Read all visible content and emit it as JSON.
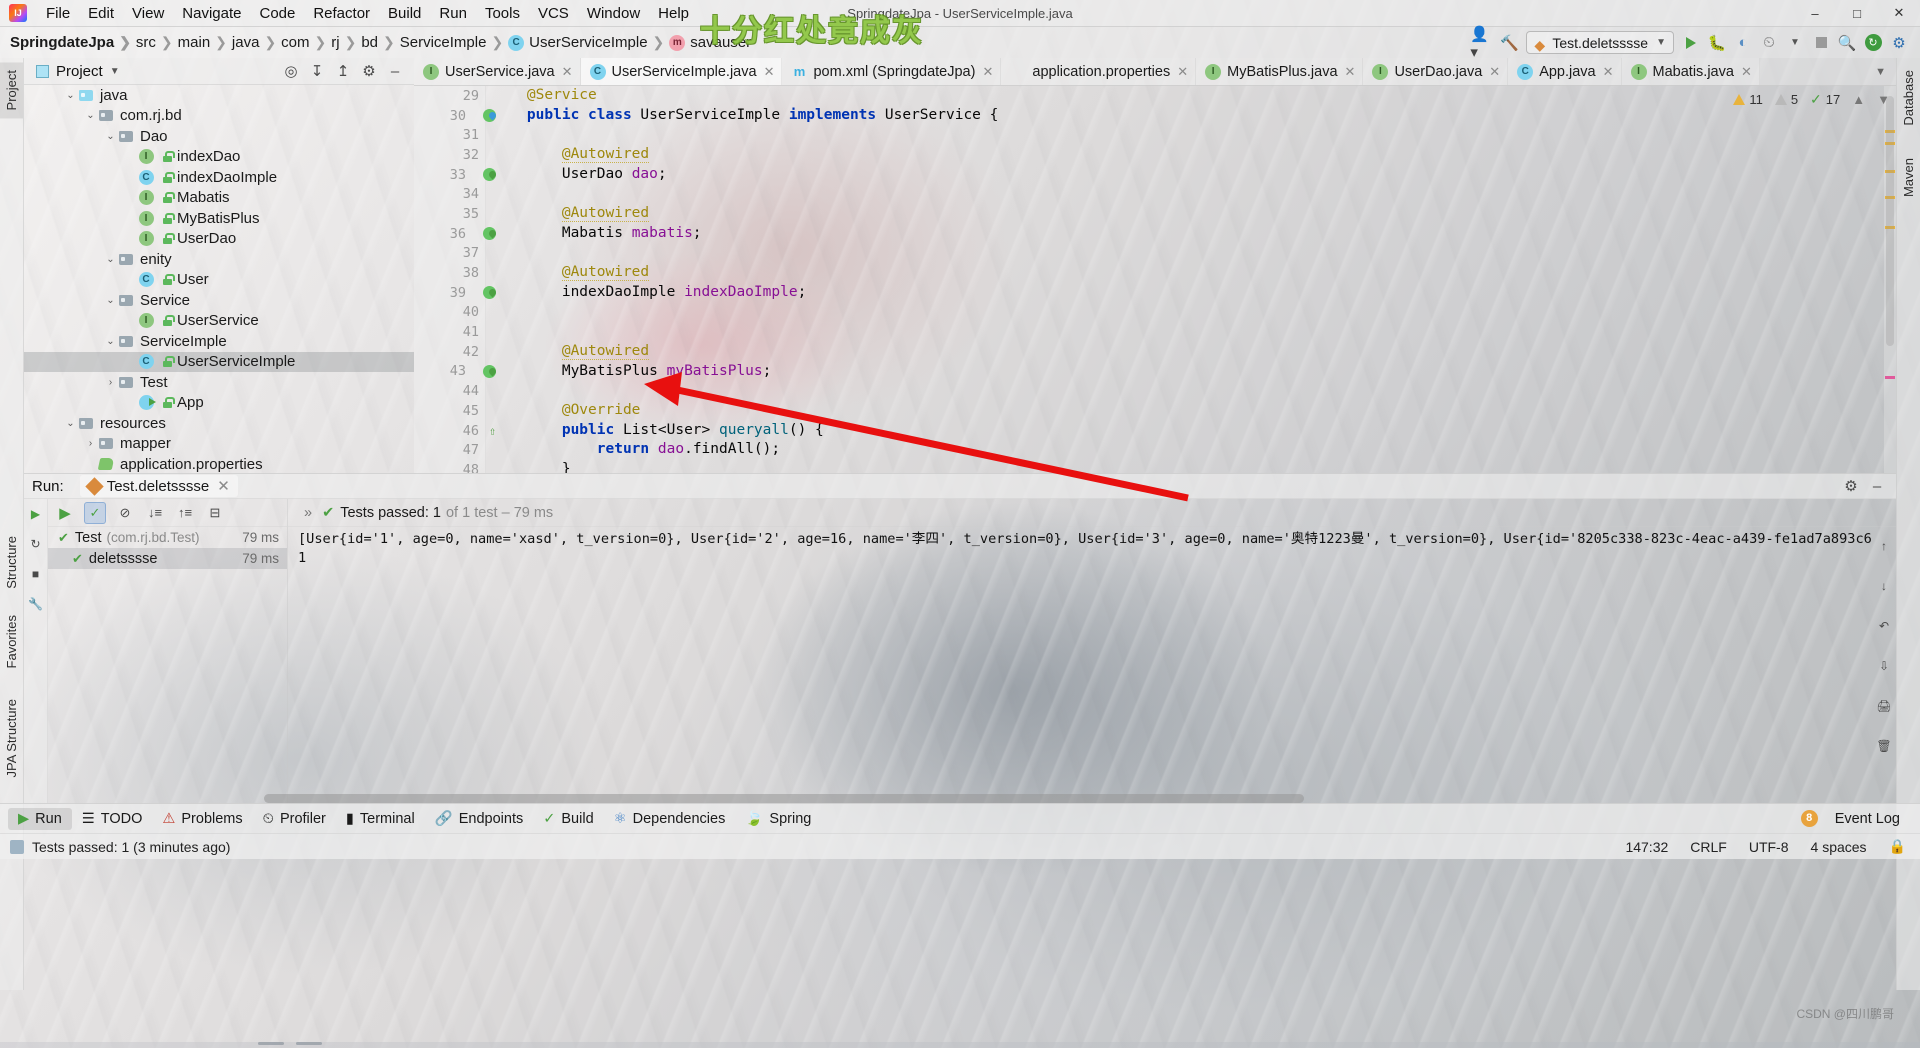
{
  "window": {
    "title": "SpringdateJpa - UserServiceImple.java",
    "logo_icon": "intellij-idea-logo",
    "minimize_icon": "minimize-icon",
    "maximize_icon": "maximize-icon",
    "close_icon": "close-icon"
  },
  "menu": [
    "File",
    "Edit",
    "View",
    "Navigate",
    "Code",
    "Refactor",
    "Build",
    "Run",
    "Tools",
    "VCS",
    "Window",
    "Help"
  ],
  "watermark": {
    "headline": "十分红处竟成灰",
    "corner": "CSDN @四川鹏哥"
  },
  "breadcrumb": [
    {
      "label": "SpringdateJpa",
      "bold": true,
      "badge": ""
    },
    {
      "label": "src",
      "bold": false,
      "badge": ""
    },
    {
      "label": "main",
      "bold": false,
      "badge": ""
    },
    {
      "label": "java",
      "bold": false,
      "badge": ""
    },
    {
      "label": "com",
      "bold": false,
      "badge": ""
    },
    {
      "label": "rj",
      "bold": false,
      "badge": ""
    },
    {
      "label": "bd",
      "bold": false,
      "badge": ""
    },
    {
      "label": "ServiceImple",
      "bold": false,
      "badge": ""
    },
    {
      "label": "UserServiceImple",
      "bold": false,
      "badge": "C"
    },
    {
      "label": "savauser",
      "bold": false,
      "badge": "m"
    }
  ],
  "navbar_right": {
    "run_config": "Test.deletsssse",
    "search_icon": "search-icon",
    "build_hammer_icon": "hammer-icon",
    "user_icon": "user-avatar-icon",
    "run_icon": "run-icon",
    "debug_icon": "debug-icon",
    "coverage_icon": "coverage-icon",
    "profiler_icon": "profiler-icon",
    "stop_icon": "stop-icon",
    "update_icon": "update-icon",
    "settings_icon": "gear-icon"
  },
  "left_strip": [
    "Project",
    "Structure",
    "Favorites",
    "JPA Structure"
  ],
  "right_strip": [
    "Database",
    "Maven"
  ],
  "project": {
    "title": "Project",
    "caret_icon": "chevron-down-icon",
    "tools": [
      "locate-icon",
      "collapse-all-icon",
      "expand-all-icon",
      "gear-icon",
      "hide-icon"
    ],
    "tree": [
      {
        "label": "java",
        "depth": 2,
        "arrow": "down",
        "icon": "folder-blue",
        "selected": false
      },
      {
        "label": "com.rj.bd",
        "depth": 3,
        "arrow": "down",
        "icon": "folder-pkg",
        "selected": false
      },
      {
        "label": "Dao",
        "depth": 4,
        "arrow": "down",
        "icon": "folder-pkg",
        "selected": false
      },
      {
        "label": "indexDao",
        "depth": 5,
        "arrow": "none",
        "icon": "interface",
        "selected": false
      },
      {
        "label": "indexDaoImple",
        "depth": 5,
        "arrow": "none",
        "icon": "class",
        "selected": false
      },
      {
        "label": "Mabatis",
        "depth": 5,
        "arrow": "none",
        "icon": "interface",
        "selected": false
      },
      {
        "label": "MyBatisPlus",
        "depth": 5,
        "arrow": "none",
        "icon": "interface",
        "selected": false
      },
      {
        "label": "UserDao",
        "depth": 5,
        "arrow": "none",
        "icon": "interface",
        "selected": false
      },
      {
        "label": "enity",
        "depth": 4,
        "arrow": "down",
        "icon": "folder-pkg",
        "selected": false
      },
      {
        "label": "User",
        "depth": 5,
        "arrow": "none",
        "icon": "class",
        "selected": false
      },
      {
        "label": "Service",
        "depth": 4,
        "arrow": "down",
        "icon": "folder-pkg",
        "selected": false
      },
      {
        "label": "UserService",
        "depth": 5,
        "arrow": "none",
        "icon": "interface",
        "selected": false
      },
      {
        "label": "ServiceImple",
        "depth": 4,
        "arrow": "down",
        "icon": "folder-pkg",
        "selected": false
      },
      {
        "label": "UserServiceImple",
        "depth": 5,
        "arrow": "none",
        "icon": "class",
        "selected": true
      },
      {
        "label": "Test",
        "depth": 4,
        "arrow": "right",
        "icon": "folder-pkg",
        "selected": false
      },
      {
        "label": "App",
        "depth": 5,
        "arrow": "none",
        "icon": "app-run",
        "selected": false
      },
      {
        "label": "resources",
        "depth": 2,
        "arrow": "down",
        "icon": "folder-res",
        "selected": false
      },
      {
        "label": "mapper",
        "depth": 3,
        "arrow": "right",
        "icon": "folder-pkg",
        "selected": false
      },
      {
        "label": "application.properties",
        "depth": 3,
        "arrow": "none",
        "icon": "properties",
        "selected": false
      }
    ]
  },
  "editor": {
    "tabs": [
      {
        "label": "UserService.java",
        "icon": "interface",
        "active": false
      },
      {
        "label": "UserServiceImple.java",
        "icon": "class",
        "active": true
      },
      {
        "label": "pom.xml (SpringdateJpa)",
        "icon": "maven",
        "active": false
      },
      {
        "label": "application.properties",
        "icon": "properties",
        "active": false
      },
      {
        "label": "MyBatisPlus.java",
        "icon": "interface",
        "active": false
      },
      {
        "label": "UserDao.java",
        "icon": "interface",
        "active": false
      },
      {
        "label": "App.java",
        "icon": "class",
        "active": false
      },
      {
        "label": "Mabatis.java",
        "icon": "interface",
        "active": false
      }
    ],
    "inspection": {
      "warnings": "11",
      "weak_warnings": "5",
      "typos": "17",
      "warning_icon": "warning-triangle-icon",
      "weak_icon": "weak-warning-triangle-icon",
      "typo_icon": "typo-check-icon",
      "collapse_icon": "chevron-up-icon",
      "expand_icon": "chevron-down-icon"
    },
    "first_line_number": 29,
    "lines": [
      {
        "num": 29,
        "gutter": "",
        "tokens": [
          {
            "t": "    ",
            "c": "pl"
          },
          {
            "t": "@Service",
            "c": "ann"
          }
        ]
      },
      {
        "num": 30,
        "gutter": "bean-blue",
        "tokens": [
          {
            "t": "    ",
            "c": "pl"
          },
          {
            "t": "public",
            "c": "kw"
          },
          {
            "t": " ",
            "c": "pl"
          },
          {
            "t": "class",
            "c": "kw"
          },
          {
            "t": " UserServiceImple ",
            "c": "pl"
          },
          {
            "t": "implements",
            "c": "kw"
          },
          {
            "t": " UserService {",
            "c": "pl"
          }
        ]
      },
      {
        "num": 31,
        "gutter": "",
        "tokens": []
      },
      {
        "num": 32,
        "gutter": "",
        "tokens": [
          {
            "t": "        ",
            "c": "pl"
          },
          {
            "t": "@Autowired",
            "c": "ann-u"
          }
        ]
      },
      {
        "num": 33,
        "gutter": "bean",
        "tokens": [
          {
            "t": "        UserDao ",
            "c": "pl"
          },
          {
            "t": "dao",
            "c": "fld"
          },
          {
            "t": ";",
            "c": "pl"
          }
        ]
      },
      {
        "num": 34,
        "gutter": "",
        "tokens": []
      },
      {
        "num": 35,
        "gutter": "",
        "tokens": [
          {
            "t": "        ",
            "c": "pl"
          },
          {
            "t": "@Autowired",
            "c": "ann-u"
          }
        ]
      },
      {
        "num": 36,
        "gutter": "bean",
        "tokens": [
          {
            "t": "        Mabatis ",
            "c": "pl"
          },
          {
            "t": "mabatis",
            "c": "fld"
          },
          {
            "t": ";",
            "c": "pl"
          }
        ]
      },
      {
        "num": 37,
        "gutter": "",
        "tokens": []
      },
      {
        "num": 38,
        "gutter": "",
        "tokens": [
          {
            "t": "        ",
            "c": "pl"
          },
          {
            "t": "@Autowired",
            "c": "ann-u"
          }
        ]
      },
      {
        "num": 39,
        "gutter": "bean",
        "tokens": [
          {
            "t": "        indexDaoImple ",
            "c": "pl"
          },
          {
            "t": "indexDaoImple",
            "c": "fld"
          },
          {
            "t": ";",
            "c": "pl"
          }
        ]
      },
      {
        "num": 40,
        "gutter": "",
        "tokens": []
      },
      {
        "num": 41,
        "gutter": "",
        "tokens": []
      },
      {
        "num": 42,
        "gutter": "",
        "tokens": [
          {
            "t": "        ",
            "c": "pl"
          },
          {
            "t": "@Autowired",
            "c": "ann-u"
          }
        ]
      },
      {
        "num": 43,
        "gutter": "bean",
        "tokens": [
          {
            "t": "        MyBatisPlus ",
            "c": "pl"
          },
          {
            "t": "myBatisPlus",
            "c": "fld"
          },
          {
            "t": ";",
            "c": "pl"
          }
        ]
      },
      {
        "num": 44,
        "gutter": "",
        "tokens": []
      },
      {
        "num": 45,
        "gutter": "",
        "tokens": [
          {
            "t": "        ",
            "c": "pl"
          },
          {
            "t": "@Override",
            "c": "ann"
          }
        ]
      },
      {
        "num": 46,
        "gutter": "override",
        "tokens": [
          {
            "t": "        ",
            "c": "pl"
          },
          {
            "t": "public",
            "c": "kw"
          },
          {
            "t": " List<User> ",
            "c": "pl"
          },
          {
            "t": "queryall",
            "c": "mth"
          },
          {
            "t": "() {",
            "c": "pl"
          }
        ]
      },
      {
        "num": 47,
        "gutter": "",
        "tokens": [
          {
            "t": "            ",
            "c": "pl"
          },
          {
            "t": "return",
            "c": "kw"
          },
          {
            "t": " ",
            "c": "pl"
          },
          {
            "t": "dao",
            "c": "fld"
          },
          {
            "t": ".findAll();",
            "c": "pl"
          }
        ]
      },
      {
        "num": 48,
        "gutter": "",
        "tokens": [
          {
            "t": "        }",
            "c": "pl"
          }
        ]
      }
    ]
  },
  "run": {
    "label": "Run:",
    "tab": "Test.deletsssse",
    "tab_close_icon": "close-icon",
    "gear_icon": "gear-icon",
    "hide_icon": "hide-icon",
    "toolbar_icons": [
      "rerun-icon",
      "filter-passed-icon",
      "mute-icon",
      "sort-alpha-icon",
      "sort-duration-icon",
      "expand-icon"
    ],
    "summary": "Tests passed: 1",
    "summary_dim": "of 1 test – 79 ms",
    "tests": [
      {
        "label": "Test",
        "dim": "(com.rj.bd.Test)",
        "ms": "79 ms",
        "indent": 0,
        "selected": false
      },
      {
        "label": "deletsssse",
        "dim": "",
        "ms": "79 ms",
        "indent": 1,
        "selected": true
      }
    ],
    "console": [
      "[User{id='1', age=0, name='xasd', t_version=0}, User{id='2', age=16, name='李四', t_version=0}, User{id='3', age=0, name='奥特1223曼', t_version=0}, User{id='8205c338-823c-4eac-a439-fe1ad7a893c6",
      "1"
    ],
    "side_icons": [
      "scroll-up-icon",
      "scroll-down-icon",
      "soft-wrap-icon",
      "export-icon",
      "print-icon",
      "trash-icon"
    ]
  },
  "bottom_tools": {
    "items": [
      {
        "label": "Run",
        "icon": "run-icon",
        "active": true
      },
      {
        "label": "TODO",
        "icon": "todo-icon",
        "active": false
      },
      {
        "label": "Problems",
        "icon": "problems-icon",
        "active": false
      },
      {
        "label": "Profiler",
        "icon": "profiler-icon",
        "active": false
      },
      {
        "label": "Terminal",
        "icon": "terminal-icon",
        "active": false
      },
      {
        "label": "Endpoints",
        "icon": "endpoints-icon",
        "active": false
      },
      {
        "label": "Build",
        "icon": "build-icon",
        "active": false
      },
      {
        "label": "Dependencies",
        "icon": "dependencies-icon",
        "active": false
      },
      {
        "label": "Spring",
        "icon": "spring-icon",
        "active": false
      }
    ],
    "event_log": "Event Log",
    "event_count": "8"
  },
  "statusbar": {
    "message": "Tests passed: 1 (3 minutes ago)",
    "caret": "147:32",
    "line_sep": "CRLF",
    "encoding": "UTF-8",
    "indent": "4 spaces",
    "save_icon": "save-indicator-icon",
    "lock_icon": "lock-icon"
  }
}
